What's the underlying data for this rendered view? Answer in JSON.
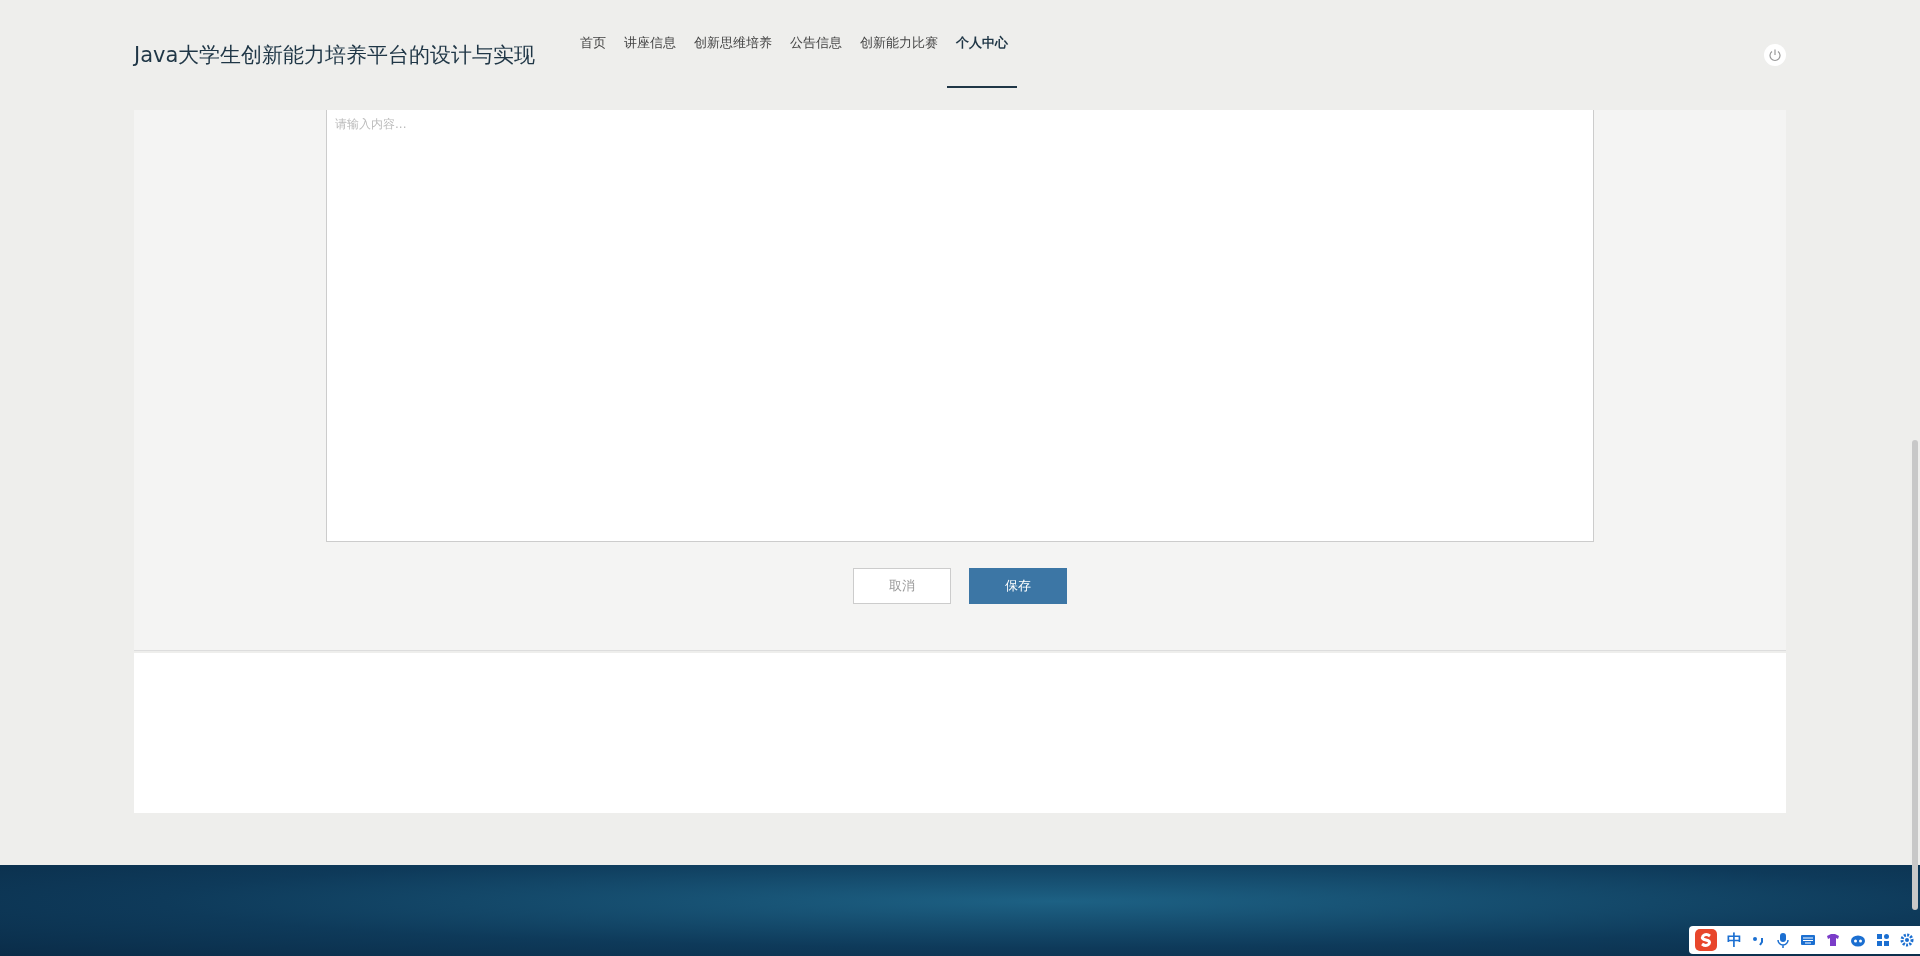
{
  "header": {
    "title": "Java大学生创新能力培养平台的设计与实现"
  },
  "nav": [
    {
      "label": "首页",
      "selected": false
    },
    {
      "label": "讲座信息",
      "selected": false
    },
    {
      "label": "创新思维培养",
      "selected": false
    },
    {
      "label": "公告信息",
      "selected": false
    },
    {
      "label": "创新能力比赛",
      "selected": false
    },
    {
      "label": "个人中心",
      "selected": true
    }
  ],
  "editor": {
    "placeholder": "请输入内容..."
  },
  "buttons": [
    {
      "label": "取消",
      "kind": "cancel"
    },
    {
      "label": "保存",
      "kind": "save"
    }
  ],
  "ime_toolbar": {
    "mode": "中"
  }
}
